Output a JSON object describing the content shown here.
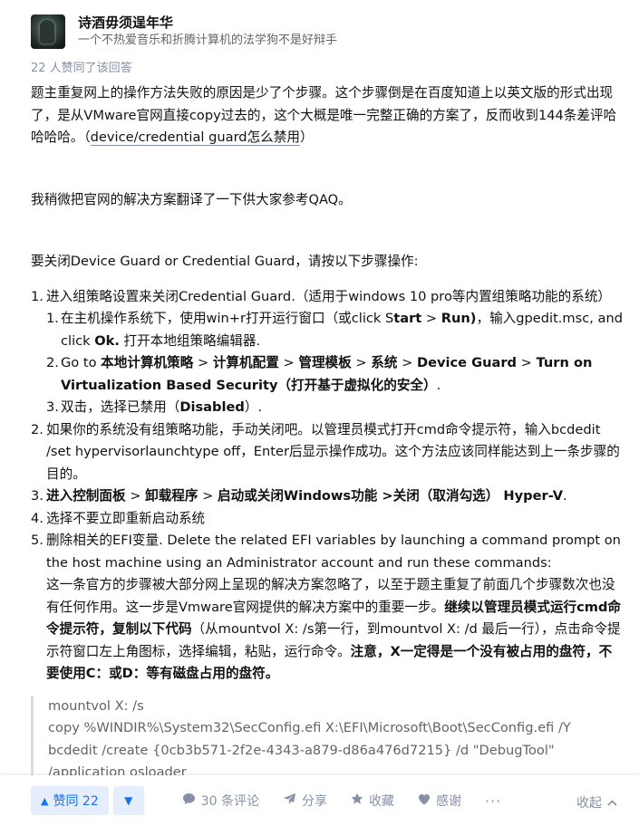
{
  "author": {
    "name": "诗酒毋须逞年华",
    "bio": "一个不热爱音乐和折腾计算机的法学狗不是好辩手"
  },
  "upvote_note": "22 人赞同了该回答",
  "content": {
    "p1_text": "题主重复网上的操作方法失败的原因是少了个步骤。这个步骤倒是在百度知道上以英文版的形式出现了，是从VMware官网直接copy过去的，这个大概是唯一完整正确的方案了，反而收到144条差评哈哈哈哈。（",
    "p1_link": "device/credential guard怎么禁用",
    "p1_end": "）",
    "p2": "我稍微把官网的解决方案翻译了一下供大家参考QAQ。",
    "p3": "要关闭Device Guard or Credential Guard，请按以下步骤操作:",
    "step1": {
      "num": "1.",
      "text": "进入组策略设置来关闭Credential Guard.（适用于windows 10 pro等内置组策略功能的系统）",
      "sub1": {
        "num": "1.",
        "a": "在主机操作系统下，使用win+r打开运行窗口（或click S",
        "b": "tart",
        "c": " > ",
        "d": "Run)",
        "e": "，输入gpedit.msc, and click ",
        "f": "Ok.",
        "g": " 打开本地组策略编辑器."
      },
      "sub2": {
        "num": "2.",
        "a": "Go to ",
        "b": "本地计算机策略",
        "c": " > ",
        "d": "计算机配置",
        "e": " > ",
        "f": "管理模板",
        "g": " > ",
        "h": "系统",
        "i": " > ",
        "j": "Device Guard",
        "k": " > ",
        "l": "Turn on Virtualization Based Security（打开基于虚拟化的安全）",
        "m": "."
      },
      "sub3": {
        "num": "3.",
        "a": "双击，选择已禁用（",
        "b": "Disabled",
        "c": "）."
      }
    },
    "step2": {
      "num": "2.",
      "text": "如果你的系统没有组策略功能，手动关闭吧。以管理员模式打开cmd命令提示符，输入bcdedit /set hypervisorlaunchtype off，Enter后显示操作成功。这个方法应该同样能达到上一条步骤的目的。"
    },
    "step3": {
      "num": "3.",
      "a": "进入控制面板",
      "b": " > ",
      "c": "卸载程序",
      "d": " > ",
      "e": "启动或关闭Windows功能",
      "f": " >关闭（取消勾选） Hyper-V",
      "g": "."
    },
    "step4": {
      "num": "4.",
      "text": "选择不要立即重新启动系统"
    },
    "step5": {
      "num": "5.",
      "a": "删除相关的EFI变量. Delete the related EFI variables by launching a command prompt on the host machine using an Administrator account and run these commands:",
      "b": "这一条官方的步骤被大部分网上呈现的解决方案忽略了，以至于题主重复了前面几个步骤数次也没有任何作用。这一步是Vmware官网提供的解决方案中的重要一步。",
      "c": "继续以管理员模式运行cmd命令提示符，复制以下代码",
      "d": "（从mountvol X: /s第一行，到mountvol X: /d 最后一行），点击命令提示符窗口左上角图标，选择编辑，粘贴，运行命令。",
      "e": "注意，X一定得是一个没有被占用的盘符，不要使用C：或D：等有磁盘占用的盘符。"
    }
  },
  "code_lines": [
    "mountvol X: /s",
    "copy %WINDIR%\\System32\\SecConfig.efi X:\\EFI\\Microsoft\\Boot\\SecConfig.efi /Y",
    "bcdedit /create {0cb3b571-2f2e-4343-a879-d86a476d7215} /d \"DebugTool\"",
    "/application osloader"
  ],
  "actions": {
    "upvote": "赞同 22",
    "upvote_icon": "▲",
    "downvote_icon": "▼",
    "comments": "30 条评论",
    "share": "分享",
    "favorite": "收藏",
    "thanks": "感谢",
    "more": "···",
    "collapse": "收起",
    "accent": "#1772f6"
  }
}
